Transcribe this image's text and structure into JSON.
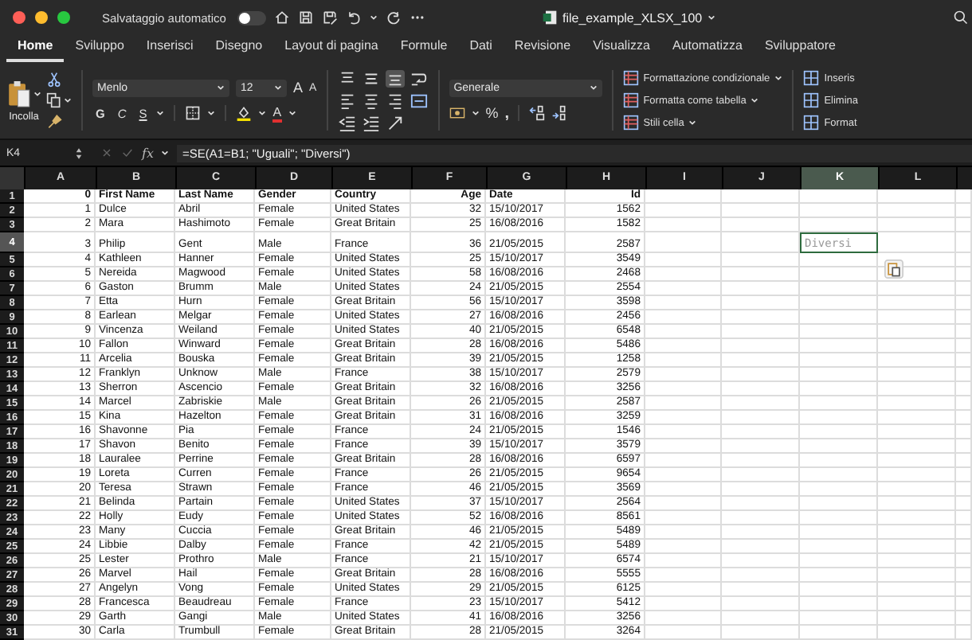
{
  "window": {
    "title": "file_example_XLSX_100",
    "autosave_label": "Salvataggio automatico",
    "autosave_on": false
  },
  "tabs": [
    {
      "label": "Home",
      "selected": true
    },
    {
      "label": "Sviluppo",
      "selected": false
    },
    {
      "label": "Inserisci",
      "selected": false
    },
    {
      "label": "Disegno",
      "selected": false
    },
    {
      "label": "Layout di pagina",
      "selected": false
    },
    {
      "label": "Formule",
      "selected": false
    },
    {
      "label": "Dati",
      "selected": false
    },
    {
      "label": "Revisione",
      "selected": false
    },
    {
      "label": "Visualizza",
      "selected": false
    },
    {
      "label": "Automatizza",
      "selected": false
    },
    {
      "label": "Sviluppatore",
      "selected": false
    }
  ],
  "ribbon": {
    "paste_label": "Incolla",
    "font_name": "Menlo",
    "font_size": "12",
    "size_buttons": [
      "A",
      "A"
    ],
    "format_buttons": [
      {
        "label": "G",
        "kind": "bold"
      },
      {
        "label": "C",
        "kind": "italic"
      },
      {
        "label": "S",
        "kind": "underline"
      }
    ],
    "font_color": "A",
    "vertical_align": [
      {
        "selected": false
      },
      {
        "selected": false
      },
      {
        "selected": true
      }
    ],
    "number_format": "Generale",
    "percent": "%",
    "comma": ",",
    "styles": [
      "Formattazione condizionale",
      "Formatta come tabella",
      "Stili cella"
    ],
    "cells": [
      "Inseris",
      "Elimina",
      "Format"
    ]
  },
  "formula_bar": {
    "name_box": "K4",
    "fx": "fx",
    "formula": "=SE(A1=B1; \"Uguali\"; \"Diversi\")"
  },
  "columns": [
    {
      "label": "A",
      "selected": false
    },
    {
      "label": "B",
      "selected": false
    },
    {
      "label": "C",
      "selected": false
    },
    {
      "label": "D",
      "selected": false
    },
    {
      "label": "E",
      "selected": false
    },
    {
      "label": "F",
      "selected": false
    },
    {
      "label": "G",
      "selected": false
    },
    {
      "label": "H",
      "selected": false
    },
    {
      "label": "I",
      "selected": false
    },
    {
      "label": "J",
      "selected": false
    },
    {
      "label": "K",
      "selected": true
    },
    {
      "label": "L",
      "selected": false
    }
  ],
  "rows": [
    {
      "number": "1",
      "selected": false,
      "cells": [
        "0",
        "First Name",
        "Last Name",
        "Gender",
        "Country",
        "Age",
        "Date",
        "Id"
      ]
    },
    {
      "number": "2",
      "selected": false,
      "cells": [
        "1",
        "Dulce",
        "Abril",
        "Female",
        "United States",
        "32",
        "15/10/2017",
        "1562"
      ]
    },
    {
      "number": "3",
      "selected": false,
      "cells": [
        "2",
        "Mara",
        "Hashimoto",
        "Female",
        "Great Britain",
        "25",
        "16/08/2016",
        "1582"
      ]
    },
    {
      "number": "4",
      "selected": true,
      "cells": [
        "3",
        "Philip",
        "Gent",
        "Male",
        "France",
        "36",
        "21/05/2015",
        "2587"
      ],
      "active_value": "Diversi"
    },
    {
      "number": "5",
      "selected": false,
      "cells": [
        "4",
        "Kathleen",
        "Hanner",
        "Female",
        "United States",
        "25",
        "15/10/2017",
        "3549"
      ]
    },
    {
      "number": "6",
      "selected": false,
      "cells": [
        "5",
        "Nereida",
        "Magwood",
        "Female",
        "United States",
        "58",
        "16/08/2016",
        "2468"
      ]
    },
    {
      "number": "7",
      "selected": false,
      "cells": [
        "6",
        "Gaston",
        "Brumm",
        "Male",
        "United States",
        "24",
        "21/05/2015",
        "2554"
      ]
    },
    {
      "number": "8",
      "selected": false,
      "cells": [
        "7",
        "Etta",
        "Hurn",
        "Female",
        "Great Britain",
        "56",
        "15/10/2017",
        "3598"
      ]
    },
    {
      "number": "9",
      "selected": false,
      "cells": [
        "8",
        "Earlean",
        "Melgar",
        "Female",
        "United States",
        "27",
        "16/08/2016",
        "2456"
      ]
    },
    {
      "number": "10",
      "selected": false,
      "cells": [
        "9",
        "Vincenza",
        "Weiland",
        "Female",
        "United States",
        "40",
        "21/05/2015",
        "6548"
      ]
    },
    {
      "number": "11",
      "selected": false,
      "cells": [
        "10",
        "Fallon",
        "Winward",
        "Female",
        "Great Britain",
        "28",
        "16/08/2016",
        "5486"
      ]
    },
    {
      "number": "12",
      "selected": false,
      "cells": [
        "11",
        "Arcelia",
        "Bouska",
        "Female",
        "Great Britain",
        "39",
        "21/05/2015",
        "1258"
      ]
    },
    {
      "number": "13",
      "selected": false,
      "cells": [
        "12",
        "Franklyn",
        "Unknow",
        "Male",
        "France",
        "38",
        "15/10/2017",
        "2579"
      ]
    },
    {
      "number": "14",
      "selected": false,
      "cells": [
        "13",
        "Sherron",
        "Ascencio",
        "Female",
        "Great Britain",
        "32",
        "16/08/2016",
        "3256"
      ]
    },
    {
      "number": "15",
      "selected": false,
      "cells": [
        "14",
        "Marcel",
        "Zabriskie",
        "Male",
        "Great Britain",
        "26",
        "21/05/2015",
        "2587"
      ]
    },
    {
      "number": "16",
      "selected": false,
      "cells": [
        "15",
        "Kina",
        "Hazelton",
        "Female",
        "Great Britain",
        "31",
        "16/08/2016",
        "3259"
      ]
    },
    {
      "number": "17",
      "selected": false,
      "cells": [
        "16",
        "Shavonne",
        "Pia",
        "Female",
        "France",
        "24",
        "21/05/2015",
        "1546"
      ]
    },
    {
      "number": "18",
      "selected": false,
      "cells": [
        "17",
        "Shavon",
        "Benito",
        "Female",
        "France",
        "39",
        "15/10/2017",
        "3579"
      ]
    },
    {
      "number": "19",
      "selected": false,
      "cells": [
        "18",
        "Lauralee",
        "Perrine",
        "Female",
        "Great Britain",
        "28",
        "16/08/2016",
        "6597"
      ]
    },
    {
      "number": "20",
      "selected": false,
      "cells": [
        "19",
        "Loreta",
        "Curren",
        "Female",
        "France",
        "26",
        "21/05/2015",
        "9654"
      ]
    },
    {
      "number": "21",
      "selected": false,
      "cells": [
        "20",
        "Teresa",
        "Strawn",
        "Female",
        "France",
        "46",
        "21/05/2015",
        "3569"
      ]
    },
    {
      "number": "22",
      "selected": false,
      "cells": [
        "21",
        "Belinda",
        "Partain",
        "Female",
        "United States",
        "37",
        "15/10/2017",
        "2564"
      ]
    },
    {
      "number": "23",
      "selected": false,
      "cells": [
        "22",
        "Holly",
        "Eudy",
        "Female",
        "United States",
        "52",
        "16/08/2016",
        "8561"
      ]
    },
    {
      "number": "24",
      "selected": false,
      "cells": [
        "23",
        "Many",
        "Cuccia",
        "Female",
        "Great Britain",
        "46",
        "21/05/2015",
        "5489"
      ]
    },
    {
      "number": "25",
      "selected": false,
      "cells": [
        "24",
        "Libbie",
        "Dalby",
        "Female",
        "France",
        "42",
        "21/05/2015",
        "5489"
      ]
    },
    {
      "number": "26",
      "selected": false,
      "cells": [
        "25",
        "Lester",
        "Prothro",
        "Male",
        "France",
        "21",
        "15/10/2017",
        "6574"
      ]
    },
    {
      "number": "27",
      "selected": false,
      "cells": [
        "26",
        "Marvel",
        "Hail",
        "Female",
        "Great Britain",
        "28",
        "16/08/2016",
        "5555"
      ]
    },
    {
      "number": "28",
      "selected": false,
      "cells": [
        "27",
        "Angelyn",
        "Vong",
        "Female",
        "United States",
        "29",
        "21/05/2015",
        "6125"
      ]
    },
    {
      "number": "29",
      "selected": false,
      "cells": [
        "28",
        "Francesca",
        "Beaudreau",
        "Female",
        "France",
        "23",
        "15/10/2017",
        "5412"
      ]
    },
    {
      "number": "30",
      "selected": false,
      "cells": [
        "29",
        "Garth",
        "Gangi",
        "Male",
        "United States",
        "41",
        "16/08/2016",
        "3256"
      ]
    },
    {
      "number": "31",
      "selected": false,
      "cells": [
        "30",
        "Carla",
        "Trumbull",
        "Female",
        "Great Britain",
        "28",
        "21/05/2015",
        "3264"
      ]
    }
  ]
}
